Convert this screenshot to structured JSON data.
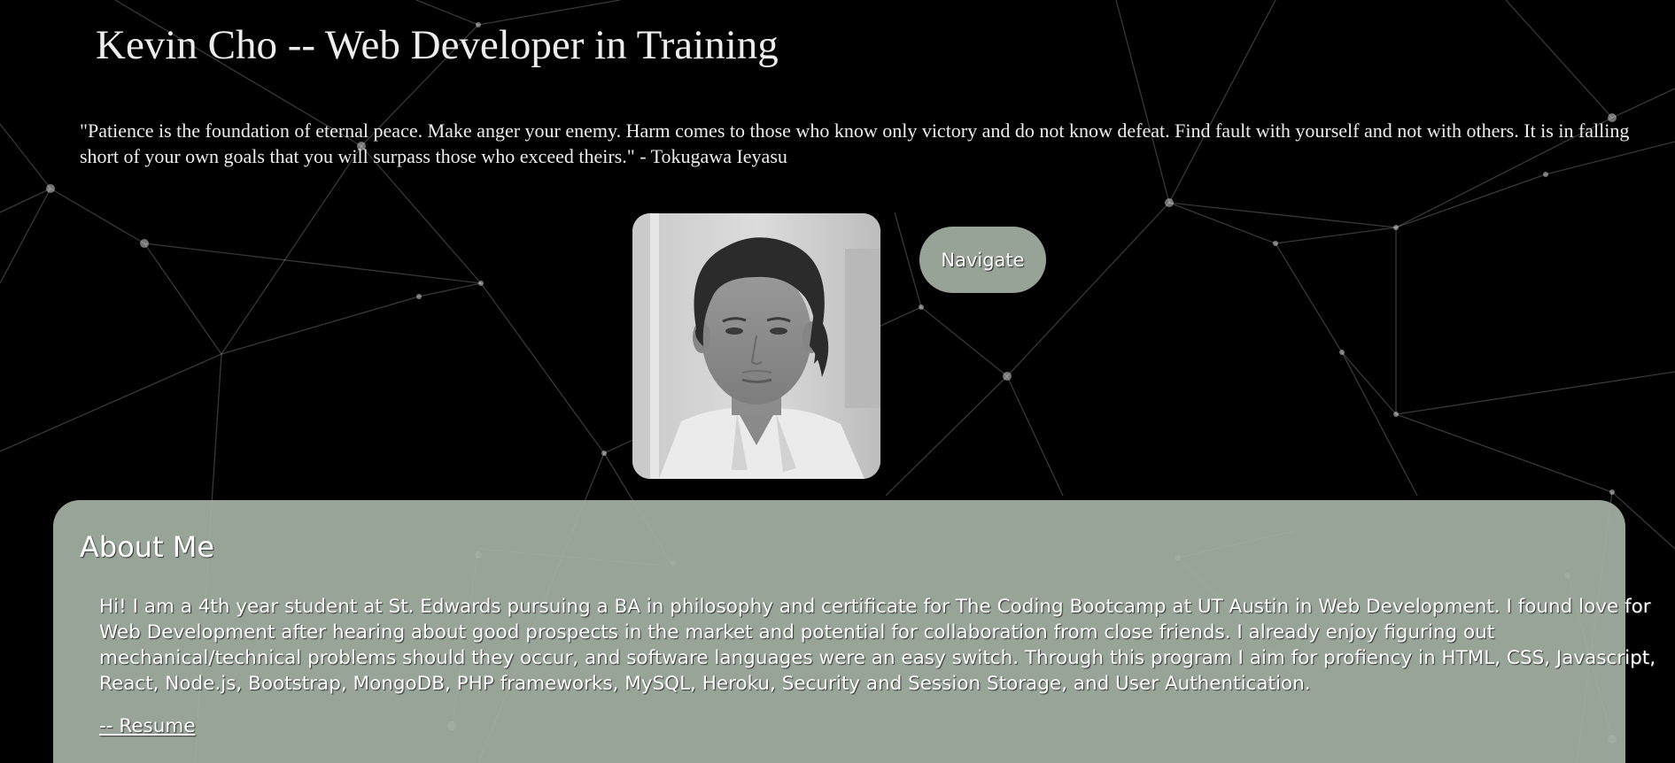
{
  "header": {
    "title": "Kevin Cho -- Web Developer in Training",
    "quote": "\"Patience is the foundation of eternal peace. Make anger your enemy. Harm comes to those who know only victory and do not know defeat. Find fault with yourself and not with others. It is in falling short of your own goals that you will surpass those who exceed theirs.\" - Tokugawa Ieyasu"
  },
  "nav": {
    "label": "Navigate"
  },
  "about": {
    "heading": "About Me",
    "body": "Hi! I am a 4th year student at St. Edwards pursuing a BA in philosophy and certificate for The Coding Bootcamp at UT Austin in Web Development. I found love for Web Development after hearing about good prospects in the market and potential for collaboration from close friends. I already enjoy figuring out mechanical/technical problems should they occur, and software languages were an easy switch. Through this program I aim for profiency in HTML, CSS, Javascript, React, Node.js, Bootstrap, MongoDB, PHP frameworks, MySQL, Heroku, Security and Session Storage, and User Authentication.",
    "resume_link": "-- Resume"
  },
  "colors": {
    "background": "#000000",
    "accent": "#98a398",
    "text": "#ffffff"
  },
  "icons": {
    "portrait": "profile-photo"
  }
}
